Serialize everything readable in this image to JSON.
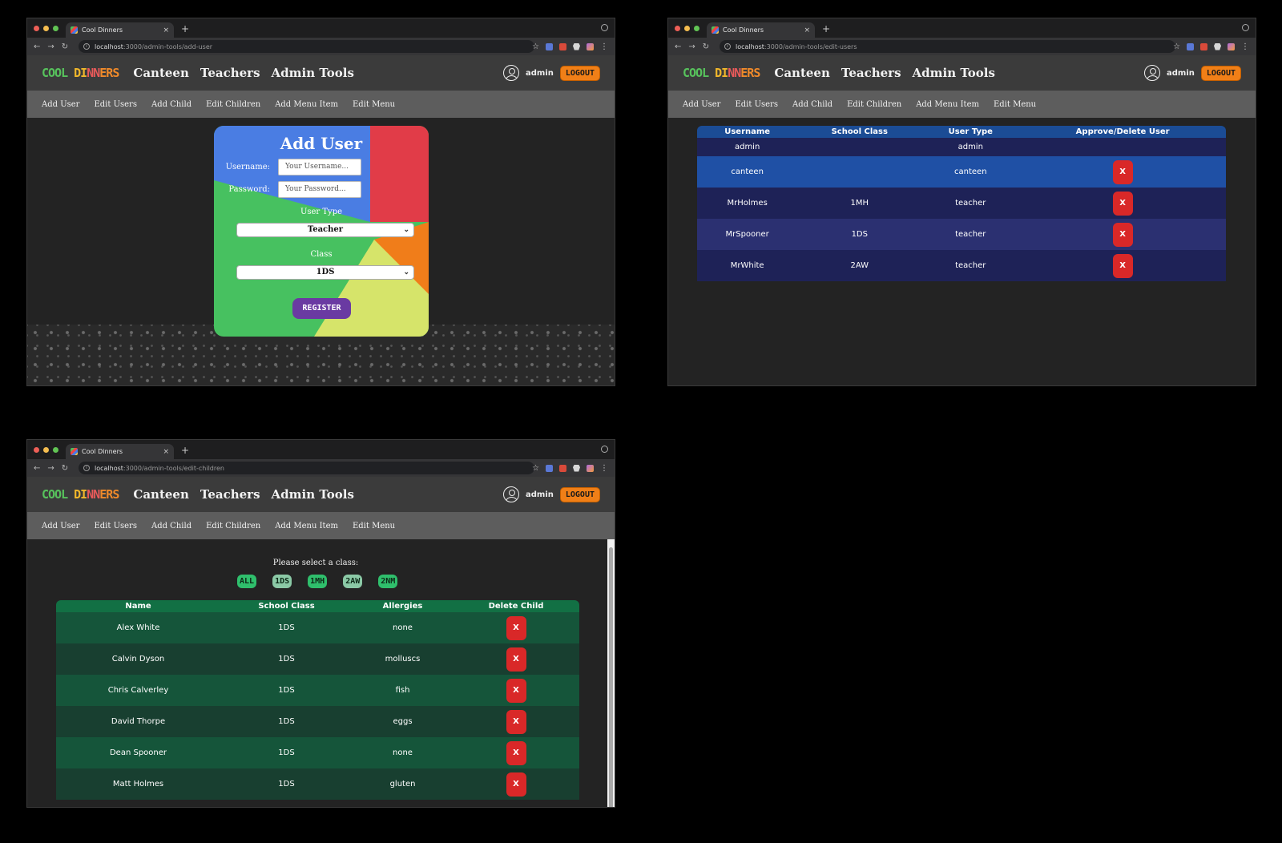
{
  "browser": {
    "tab_title": "Cool Dinners",
    "tab_close": "×",
    "new_tab": "+",
    "url_host": "localhost",
    "windows": [
      {
        "url_path": ":3000/admin-tools/add-user"
      },
      {
        "url_path": ":3000/admin-tools/edit-users"
      },
      {
        "url_path": ":3000/admin-tools/edit-children"
      }
    ],
    "nav_icons": [
      "back-arrow-icon",
      "forward-arrow-icon",
      "reload-icon",
      "info-icon",
      "star-icon",
      "key-icon",
      "extensions-icon",
      "kebab-menu-icon"
    ]
  },
  "app": {
    "logo": {
      "part1": "COOL ",
      "part2": "DI",
      "part3": "NN",
      "part4": "ERS"
    },
    "nav": [
      "Canteen",
      "Teachers",
      "Admin Tools"
    ],
    "user": "admin",
    "logout": "LOGOUT",
    "subnav": [
      "Add User",
      "Edit Users",
      "Add Child",
      "Edit Children",
      "Add Menu Item",
      "Edit Menu"
    ],
    "colors": {
      "logout": "#f07f17",
      "register": "#6a3aa2",
      "delete": "#d92828",
      "users_header": "#1b4c95",
      "children_header": "#127044"
    }
  },
  "add_user": {
    "title": "Add User",
    "username_label": "Username:",
    "username_placeholder": "Your Username...",
    "password_label": "Password:",
    "password_placeholder": "Your Password...",
    "user_type_label": "User Type",
    "user_type_value": "Teacher",
    "class_label": "Class",
    "class_value": "1DS",
    "register": "REGISTER"
  },
  "edit_users": {
    "columns": [
      "Username",
      "School Class",
      "User Type",
      "Approve/Delete User"
    ],
    "rows": [
      {
        "username": "admin",
        "class": "",
        "type": "admin",
        "action": ""
      },
      {
        "username": "canteen",
        "class": "",
        "type": "canteen",
        "action": "X"
      },
      {
        "username": "MrHolmes",
        "class": "1MH",
        "type": "teacher",
        "action": "X"
      },
      {
        "username": "MrSpooner",
        "class": "1DS",
        "type": "teacher",
        "action": "X"
      },
      {
        "username": "MrWhite",
        "class": "2AW",
        "type": "teacher",
        "action": "X"
      }
    ]
  },
  "edit_children": {
    "prompt": "Please select a class:",
    "classes": [
      "ALL",
      "1DS",
      "1MH",
      "2AW",
      "2NM"
    ],
    "columns": [
      "Name",
      "School Class",
      "Allergies",
      "Delete Child"
    ],
    "rows": [
      {
        "name": "Alex White",
        "class": "1DS",
        "allergies": "none",
        "action": "X"
      },
      {
        "name": "Calvin Dyson",
        "class": "1DS",
        "allergies": "molluscs",
        "action": "X"
      },
      {
        "name": "Chris Calverley",
        "class": "1DS",
        "allergies": "fish",
        "action": "X"
      },
      {
        "name": "David Thorpe",
        "class": "1DS",
        "allergies": "eggs",
        "action": "X"
      },
      {
        "name": "Dean Spooner",
        "class": "1DS",
        "allergies": "none",
        "action": "X"
      },
      {
        "name": "Matt Holmes",
        "class": "1DS",
        "allergies": "gluten",
        "action": "X"
      }
    ]
  }
}
